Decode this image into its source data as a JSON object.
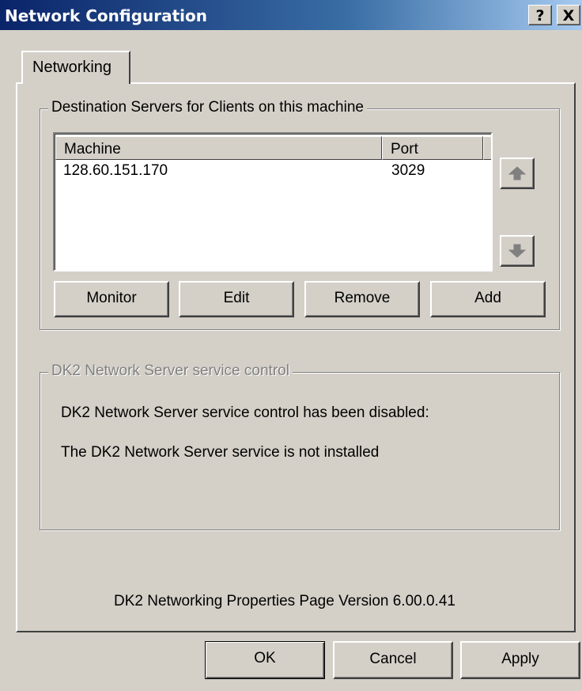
{
  "window": {
    "title": "Network Configuration",
    "help_label": "?",
    "close_label": "X"
  },
  "tabs": [
    {
      "label": "Networking"
    }
  ],
  "destination": {
    "legend": "Destination Servers for Clients on this machine",
    "columns": [
      "Machine",
      "Port"
    ],
    "rows": [
      {
        "machine": "128.60.151.170",
        "port": "3029"
      }
    ],
    "move_up_icon": "arrow-up-icon",
    "move_down_icon": "arrow-down-icon",
    "buttons": {
      "monitor": "Monitor",
      "edit": "Edit",
      "remove": "Remove",
      "add": "Add"
    }
  },
  "service": {
    "legend": "DK2 Network Server service control",
    "line1": "DK2 Network Server service control has been disabled:",
    "line2": "The DK2 Network Server service is not installed"
  },
  "version_text": "DK2 Networking Properties Page Version 6.00.0.41",
  "footer": {
    "ok": "OK",
    "cancel": "Cancel",
    "apply": "Apply"
  },
  "colors": {
    "titlebar_start": "#0a246a",
    "titlebar_end": "#a6caf0",
    "dialog_face": "#d4d0c8"
  }
}
